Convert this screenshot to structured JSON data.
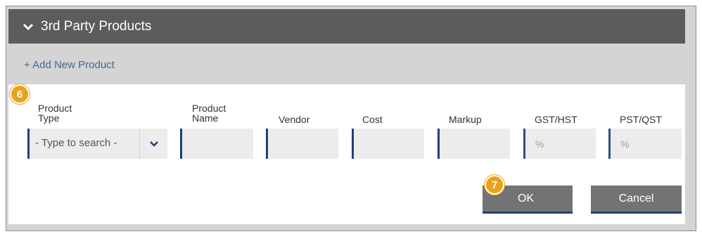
{
  "section": {
    "title": "3rd Party Products",
    "add_link": "+ Add New Product"
  },
  "badges": {
    "step6": "6",
    "step7": "7"
  },
  "columns": {
    "product_type": [
      "Product",
      "Type"
    ],
    "product_name": [
      "Product",
      "Name"
    ],
    "vendor": "Vendor",
    "cost": "Cost",
    "markup": "Markup",
    "gst_hst": "GST/HST",
    "pst_qst": "PST/QST"
  },
  "fields": {
    "product_type_placeholder": "- Type to search -",
    "gst_hst_unit": "%",
    "pst_qst_unit": "%"
  },
  "buttons": {
    "ok": "OK",
    "cancel": "Cancel"
  },
  "icons": {
    "section_toggle": "chevron-down-icon",
    "select_arrow": "chevron-down-icon"
  },
  "colors": {
    "header_bg": "#5c5c5c",
    "link": "#3e6a94",
    "badge": "#e9a31b",
    "field_accent": "#1f3f7a",
    "button_bg": "#737373"
  }
}
